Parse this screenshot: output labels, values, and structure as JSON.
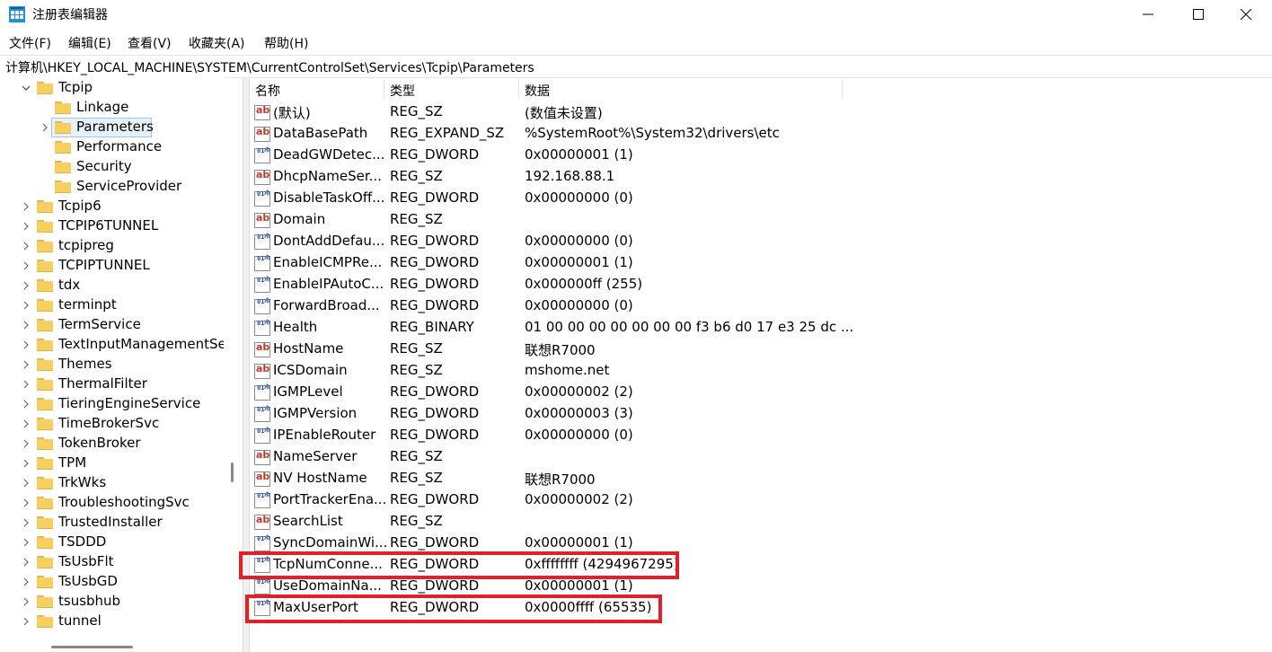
{
  "window": {
    "title": "注册表编辑器",
    "accent": "#0078d4",
    "highlight_color": "#e0212a"
  },
  "menu": [
    "文件(F)",
    "编辑(E)",
    "查看(V)",
    "收藏夹(A)",
    "帮助(H)"
  ],
  "address": "计算机\\HKEY_LOCAL_MACHINE\\SYSTEM\\CurrentControlSet\\Services\\Tcpip\\Parameters",
  "tree": {
    "selected": "Parameters",
    "items": [
      {
        "label": "Tcpip",
        "expand": "open",
        "level": 1
      },
      {
        "label": "Linkage",
        "expand": "none",
        "level": 2
      },
      {
        "label": "Parameters",
        "expand": "closed",
        "level": 2
      },
      {
        "label": "Performance",
        "expand": "none",
        "level": 2
      },
      {
        "label": "Security",
        "expand": "none",
        "level": 2
      },
      {
        "label": "ServiceProvider",
        "expand": "none",
        "level": 2
      },
      {
        "label": "Tcpip6",
        "expand": "closed",
        "level": 1
      },
      {
        "label": "TCPIP6TUNNEL",
        "expand": "closed",
        "level": 1
      },
      {
        "label": "tcpipreg",
        "expand": "closed",
        "level": 1
      },
      {
        "label": "TCPIPTUNNEL",
        "expand": "closed",
        "level": 1
      },
      {
        "label": "tdx",
        "expand": "closed",
        "level": 1
      },
      {
        "label": "terminpt",
        "expand": "closed",
        "level": 1
      },
      {
        "label": "TermService",
        "expand": "closed",
        "level": 1
      },
      {
        "label": "TextInputManagementSe",
        "expand": "closed",
        "level": 1
      },
      {
        "label": "Themes",
        "expand": "closed",
        "level": 1
      },
      {
        "label": "ThermalFilter",
        "expand": "closed",
        "level": 1
      },
      {
        "label": "TieringEngineService",
        "expand": "closed",
        "level": 1
      },
      {
        "label": "TimeBrokerSvc",
        "expand": "closed",
        "level": 1
      },
      {
        "label": "TokenBroker",
        "expand": "closed",
        "level": 1
      },
      {
        "label": "TPM",
        "expand": "closed",
        "level": 1
      },
      {
        "label": "TrkWks",
        "expand": "closed",
        "level": 1
      },
      {
        "label": "TroubleshootingSvc",
        "expand": "closed",
        "level": 1
      },
      {
        "label": "TrustedInstaller",
        "expand": "closed",
        "level": 1
      },
      {
        "label": "TSDDD",
        "expand": "closed",
        "level": 1
      },
      {
        "label": "TsUsbFlt",
        "expand": "closed",
        "level": 1
      },
      {
        "label": "TsUsbGD",
        "expand": "closed",
        "level": 1
      },
      {
        "label": "tsusbhub",
        "expand": "closed",
        "level": 1
      },
      {
        "label": "tunnel",
        "expand": "closed",
        "level": 1
      }
    ]
  },
  "columns": {
    "name": "名称",
    "type": "类型",
    "data": "数据"
  },
  "values": [
    {
      "icon": "string-value-icon",
      "name": "(默认)",
      "type": "REG_SZ",
      "data": "(数值未设置)"
    },
    {
      "icon": "string-value-icon",
      "name": "DataBasePath",
      "type": "REG_EXPAND_SZ",
      "data": "%SystemRoot%\\System32\\drivers\\etc"
    },
    {
      "icon": "binary-value-icon",
      "name": "DeadGWDetec...",
      "type": "REG_DWORD",
      "data": "0x00000001 (1)"
    },
    {
      "icon": "string-value-icon",
      "name": "DhcpNameSer...",
      "type": "REG_SZ",
      "data": "192.168.88.1"
    },
    {
      "icon": "binary-value-icon",
      "name": "DisableTaskOff...",
      "type": "REG_DWORD",
      "data": "0x00000000 (0)"
    },
    {
      "icon": "string-value-icon",
      "name": "Domain",
      "type": "REG_SZ",
      "data": ""
    },
    {
      "icon": "binary-value-icon",
      "name": "DontAddDefau...",
      "type": "REG_DWORD",
      "data": "0x00000000 (0)"
    },
    {
      "icon": "binary-value-icon",
      "name": "EnableICMPRe...",
      "type": "REG_DWORD",
      "data": "0x00000001 (1)"
    },
    {
      "icon": "binary-value-icon",
      "name": "EnableIPAutoC...",
      "type": "REG_DWORD",
      "data": "0x000000ff (255)"
    },
    {
      "icon": "binary-value-icon",
      "name": "ForwardBroad...",
      "type": "REG_DWORD",
      "data": "0x00000000 (0)"
    },
    {
      "icon": "binary-value-icon",
      "name": "Health",
      "type": "REG_BINARY",
      "data": "01 00 00 00 00 00 00 00 f3 b6 d0 17 e3 25 dc ..."
    },
    {
      "icon": "string-value-icon",
      "name": "HostName",
      "type": "REG_SZ",
      "data": "联想R7000"
    },
    {
      "icon": "string-value-icon",
      "name": "ICSDomain",
      "type": "REG_SZ",
      "data": "mshome.net"
    },
    {
      "icon": "binary-value-icon",
      "name": "IGMPLevel",
      "type": "REG_DWORD",
      "data": "0x00000002 (2)"
    },
    {
      "icon": "binary-value-icon",
      "name": "IGMPVersion",
      "type": "REG_DWORD",
      "data": "0x00000003 (3)"
    },
    {
      "icon": "binary-value-icon",
      "name": "IPEnableRouter",
      "type": "REG_DWORD",
      "data": "0x00000000 (0)"
    },
    {
      "icon": "string-value-icon",
      "name": "NameServer",
      "type": "REG_SZ",
      "data": ""
    },
    {
      "icon": "string-value-icon",
      "name": "NV HostName",
      "type": "REG_SZ",
      "data": "联想R7000"
    },
    {
      "icon": "binary-value-icon",
      "name": "PortTrackerEna...",
      "type": "REG_DWORD",
      "data": "0x00000002 (2)"
    },
    {
      "icon": "string-value-icon",
      "name": "SearchList",
      "type": "REG_SZ",
      "data": ""
    },
    {
      "icon": "binary-value-icon",
      "name": "SyncDomainWi...",
      "type": "REG_DWORD",
      "data": "0x00000001 (1)"
    },
    {
      "icon": "binary-value-icon",
      "name": "TcpNumConne...",
      "type": "REG_DWORD",
      "data": "0xffffffff (4294967295)",
      "highlighted": true
    },
    {
      "icon": "binary-value-icon",
      "name": "UseDomainNa...",
      "type": "REG_DWORD",
      "data": "0x00000001 (1)"
    },
    {
      "icon": "binary-value-icon",
      "name": "MaxUserPort",
      "type": "REG_DWORD",
      "data": "0x0000ffff (65535)",
      "highlighted": true
    }
  ]
}
